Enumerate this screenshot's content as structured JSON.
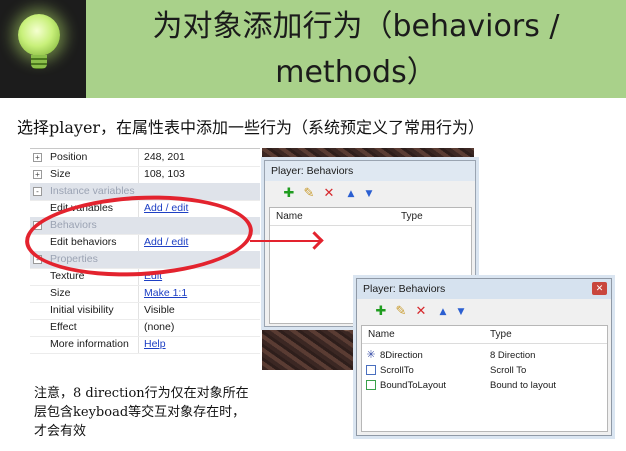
{
  "header": {
    "title_line1": "为对象添加行为（behaviors /",
    "title_line2": "methods）"
  },
  "subtitle": "选择player，在属性表中添加一些行为（系统预定义了常用行为）",
  "properties": [
    {
      "key": "Position",
      "value": "248, 201",
      "expander": "+",
      "link": false,
      "group": false
    },
    {
      "key": "Size",
      "value": "108, 103",
      "expander": "+",
      "link": false,
      "group": false
    },
    {
      "key": "Instance variables",
      "value": "",
      "expander": "-",
      "link": false,
      "group": true
    },
    {
      "key": "Edit variables",
      "value": "Add / edit",
      "expander": "",
      "link": true,
      "group": false
    },
    {
      "key": "Behaviors",
      "value": "",
      "expander": "-",
      "link": false,
      "group": true
    },
    {
      "key": "Edit behaviors",
      "value": "Add / edit",
      "expander": "",
      "link": true,
      "group": false
    },
    {
      "key": "Properties",
      "value": "",
      "expander": "-",
      "link": false,
      "group": true
    },
    {
      "key": "Texture",
      "value": "Edit",
      "expander": "",
      "link": true,
      "group": false
    },
    {
      "key": "Size",
      "value": "Make 1:1",
      "expander": "",
      "link": true,
      "group": false
    },
    {
      "key": "Initial visibility",
      "value": "Visible",
      "expander": "",
      "link": false,
      "group": false
    },
    {
      "key": "Effect",
      "value": "(none)",
      "expander": "",
      "link": false,
      "group": false
    },
    {
      "key": "More information",
      "value": "Help",
      "expander": "",
      "link": true,
      "group": false
    }
  ],
  "dialog1": {
    "title": "Player: Behaviors",
    "col_name": "Name",
    "col_type": "Type"
  },
  "dialog2": {
    "title": "Player: Behaviors",
    "col_name": "Name",
    "col_type": "Type",
    "rows": [
      {
        "name": "8Direction",
        "type": "8 Direction",
        "icon": "eight-direction-icon"
      },
      {
        "name": "ScrollTo",
        "type": "Scroll To",
        "icon": "scroll-to-icon"
      },
      {
        "name": "BoundToLayout",
        "type": "Bound to layout",
        "icon": "bound-to-layout-icon"
      }
    ]
  },
  "toolbar_icons": [
    "add-icon",
    "edit-icon",
    "delete-icon",
    "move-up-icon",
    "move-down-icon"
  ],
  "note": {
    "line1": "注意，8 direction行为仅在对象所在",
    "line2": "层包含keyboad等交互对象存在时，",
    "line3": "才会有效"
  },
  "colors": {
    "header_band": "#a9d18a",
    "highlight": "#e3232e",
    "link": "#1d3fc4"
  }
}
